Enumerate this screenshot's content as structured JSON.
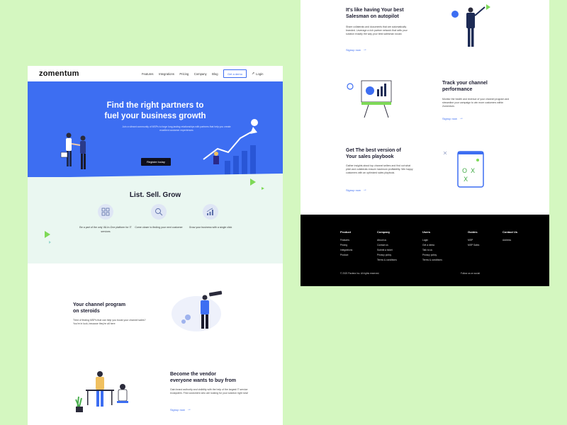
{
  "nav": {
    "logo": "zomentum",
    "links": [
      "Features",
      "Integrations",
      "Pricing",
      "Company",
      "Blog"
    ],
    "cta": "Get a demo",
    "login": "Login"
  },
  "hero": {
    "title_line1": "Find the right partners to",
    "title_line2": "fuel your business growth",
    "subtitle": "Join a vibrant community of MSPs to forge long-lasting relationships with partners that help you create excellent customer experiences",
    "button": "Register today"
  },
  "list_sell_grow": {
    "title": "List. Sell. Grow",
    "features": [
      {
        "text": "Be a part of the only 'All-In-One platform for IT services",
        "icon": "grid-icon"
      },
      {
        "text": "Come closer to finding your next customer",
        "icon": "magnifier-icon"
      },
      {
        "text": "Grow your business with a single click",
        "icon": "growth-chart-icon"
      }
    ]
  },
  "section_channel": {
    "title_line1": "Your channel program",
    "title_line2": "on steroids",
    "body": "Tired of finding MSPs that can help you boost your channel sales? You're in luck, because they're all here"
  },
  "section_vendor": {
    "title_line1": "Become the vendor",
    "title_line2": "everyone wants to buy from",
    "body": "Gain brand authority and visibility with the help of the largest IT service ecosystem. Find customers who are looking for your solution right now!",
    "signup": "Signup now"
  },
  "section_salesman": {
    "title_line1": "It's like having Your best",
    "title_line2": "Salesman on autopilot",
    "body": "Share collaterals and documents that are automatically branded. Leverage a rich partner network that sells your solution exactly the way your best salesman would.",
    "signup": "Signup now"
  },
  "section_track": {
    "title_line1": "Track your channel",
    "title_line2": "performance",
    "body": "Monitor the health and revenue of your channel program and streamline your campaign to win more customers within Zomentum.",
    "signup": "Signup now"
  },
  "section_playbook": {
    "title_line1": "Get The best version of",
    "title_line2": "Your sales playbook",
    "body": "Gather insights about top channel sellers and find out what pitch and collaterals ensure maximum profitability. Win happy customers with an optimized sales playbook.",
    "signup": "Signup now"
  },
  "footer": {
    "columns": [
      {
        "head": "Product",
        "items": [
          "Features",
          "Pricing",
          "Integrations",
          "Product"
        ]
      },
      {
        "head": "Company",
        "items": [
          "About us",
          "Contact us",
          "Submit a ticket",
          "Privacy policy",
          "Terms & conditions"
        ]
      },
      {
        "head": "Users",
        "items": [
          "Login",
          "Get a demo",
          "Talk to us",
          "Privacy policy",
          "Terms & conditions"
        ]
      },
      {
        "head": "Guides",
        "items": [
          "MSP",
          "MSP Sales"
        ]
      },
      {
        "head": "Contact Us",
        "items": [
          "Address"
        ]
      }
    ],
    "copyright": "© 2020 Pactera Inc. All rights reserved.",
    "follow": "Follow us on social"
  },
  "colors": {
    "brand_blue": "#3d6ef2",
    "page_bg": "#d4f7c0",
    "accent_green": "#7ed957",
    "footer_bg": "#000000"
  }
}
